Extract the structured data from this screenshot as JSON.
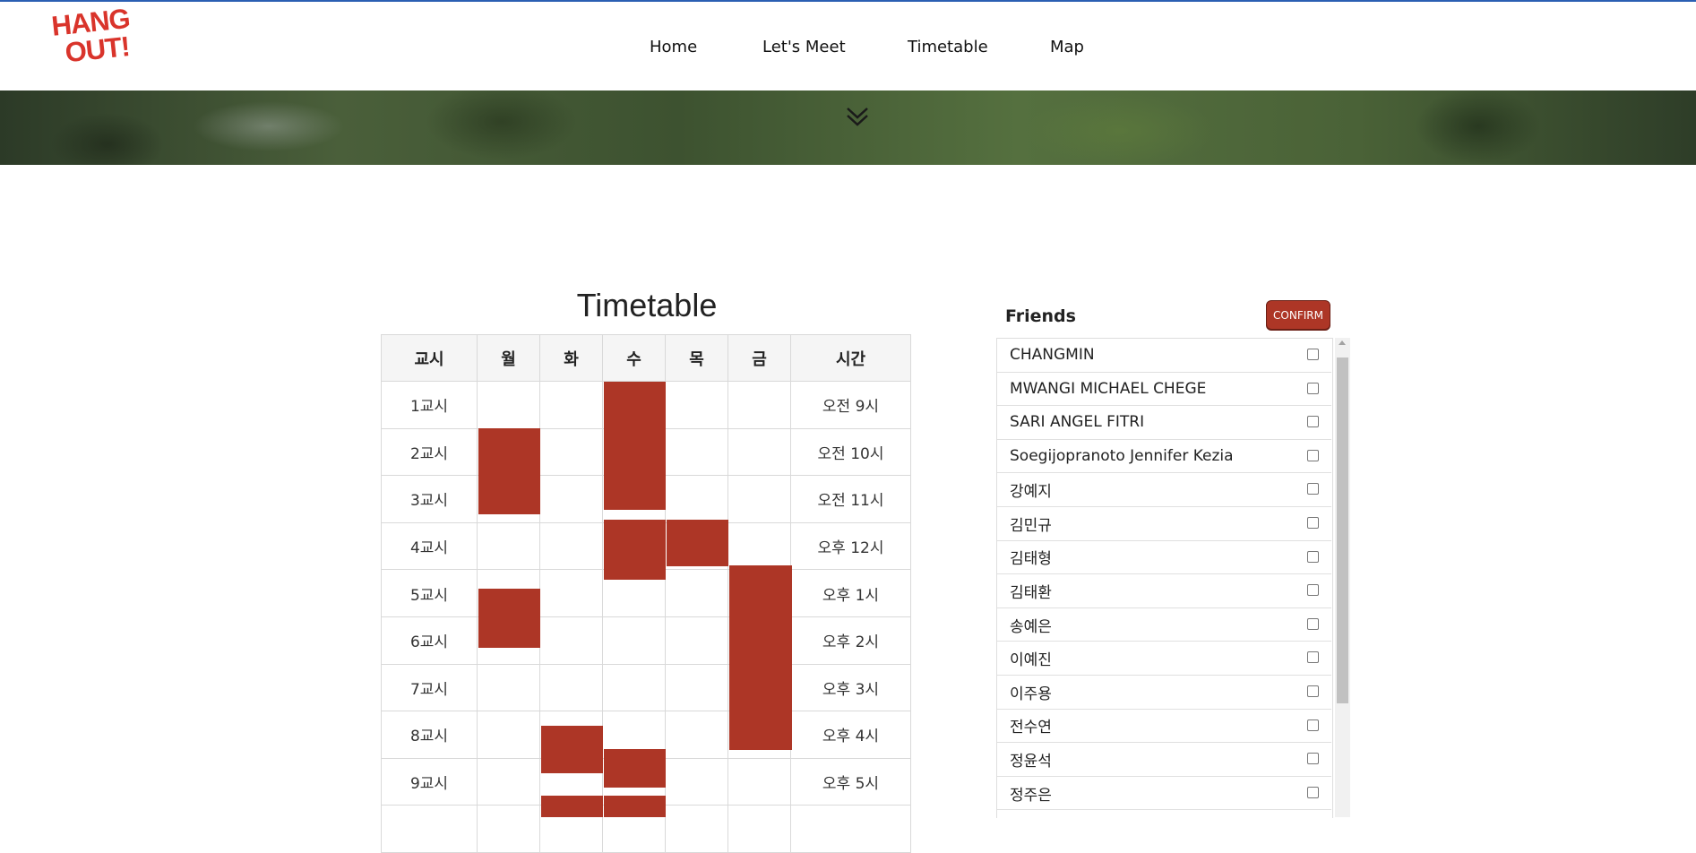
{
  "brand": {
    "line1": "HANG",
    "line2": "OUT!"
  },
  "nav": {
    "home": "Home",
    "meet": "Let's Meet",
    "timetable": "Timetable",
    "map": "Map"
  },
  "timetable": {
    "title": "Timetable",
    "headers": [
      "교시",
      "월",
      "화",
      "수",
      "목",
      "금",
      "시간"
    ],
    "periods": [
      "1교시",
      "2교시",
      "3교시",
      "4교시",
      "5교시",
      "6교시",
      "7교시",
      "8교시",
      "9교시"
    ],
    "times": [
      "오전 9시",
      "오전 10시",
      "오전 11시",
      "오후 12시",
      "오후 1시",
      "오후 2시",
      "오후 3시",
      "오후 4시",
      "오후 5시"
    ],
    "accent_color": "#ad3626"
  },
  "friends": {
    "title": "Friends",
    "confirm_label": "CONFIRM",
    "items": [
      "CHANGMIN",
      "MWANGI MICHAEL CHEGE",
      "SARI ANGEL FITRI",
      "Soegijopranoto Jennifer Kezia",
      "강예지",
      "김민규",
      "김태형",
      "김태환",
      "송예은",
      "이예진",
      "이주용",
      "전수연",
      "정윤석",
      "정주은"
    ]
  }
}
